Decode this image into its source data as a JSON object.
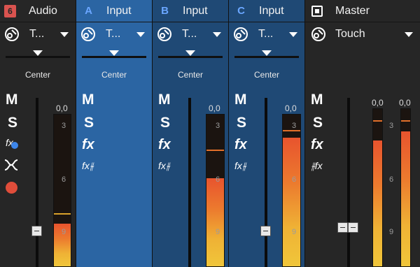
{
  "strips": [
    {
      "id": "audio",
      "badge": "6",
      "name": "Audio",
      "automation": "T...",
      "pan": "Center"
    },
    {
      "id": "a",
      "badge": "A",
      "name": "Input",
      "automation": "T...",
      "pan": "Center"
    },
    {
      "id": "b",
      "badge": "B",
      "name": "Input",
      "automation": "T...",
      "pan": "Center"
    },
    {
      "id": "c",
      "badge": "C",
      "name": "Input",
      "automation": "T...",
      "pan": "Center"
    },
    {
      "id": "master",
      "badge": "",
      "name": "Master",
      "automation": "Touch"
    }
  ],
  "buttons": {
    "mute": "M",
    "solo": "S",
    "fx": "fx",
    "fx_small": "fx"
  },
  "meter": {
    "peak_value": "0,0",
    "scale": [
      "3",
      "6",
      "9"
    ]
  },
  "meter_levels": {
    "audio": {
      "level": 0.28,
      "peak": 0.34
    },
    "a": {
      "level": 0.72,
      "peak": 0.84
    },
    "b": {
      "level": 0.58,
      "peak": 0.76
    },
    "c": {
      "level": 0.85,
      "peak": 0.89
    },
    "master_l": {
      "level": 0.8,
      "peak": 0.92
    },
    "master_r": {
      "level": 0.86,
      "peak": 0.92
    }
  },
  "colors": {
    "selected_strip": "#2b65a3",
    "input_strip": "#1f4975",
    "record": "#e04d3a",
    "fx_active": "#3d86ea"
  }
}
